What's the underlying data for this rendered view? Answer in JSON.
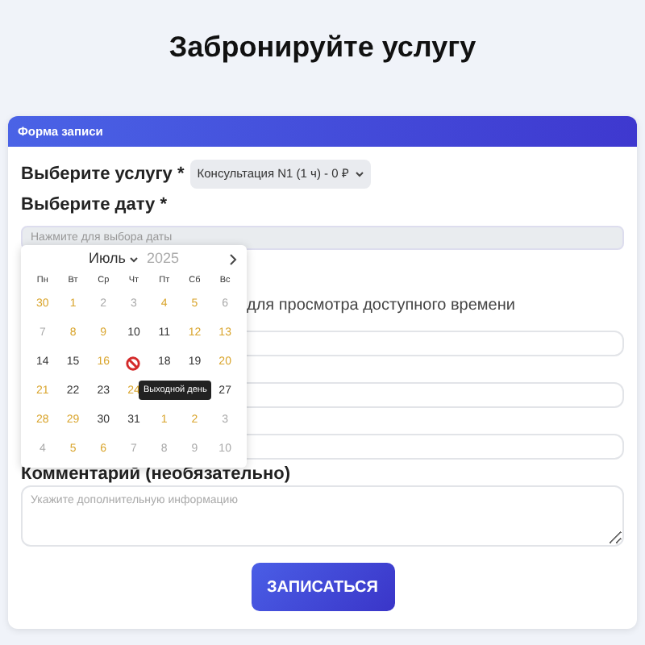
{
  "page_title": "Забронируйте услугу",
  "form": {
    "header": "Форма записи",
    "service": {
      "label": "Выберите услугу *",
      "value": "Консультация N1 (1 ч) - 0 ₽"
    },
    "date": {
      "label": "Выберите дату *",
      "placeholder": "Нажмите для выбора даты"
    },
    "time_hint": "для просмотра доступного времени",
    "covered_fields": [
      {
        "kind": "input"
      },
      {
        "kind": "input"
      },
      {
        "kind": "input"
      }
    ],
    "comment": {
      "label": "Комментарий (необязательно)",
      "placeholder": "Укажите дополнительную информацию"
    },
    "submit": "ЗАПИСАТЬСЯ"
  },
  "calendar": {
    "month": "Июль",
    "year": "2025",
    "weekdays": [
      "Пн",
      "Вт",
      "Ср",
      "Чт",
      "Пт",
      "Сб",
      "Вс"
    ],
    "weeks": [
      [
        {
          "text": "30",
          "kind": "available"
        },
        {
          "text": "1",
          "kind": "available"
        },
        {
          "text": "2",
          "kind": "muted"
        },
        {
          "text": "3",
          "kind": "muted"
        },
        {
          "text": "4",
          "kind": "available"
        },
        {
          "text": "5",
          "kind": "available"
        },
        {
          "text": "6",
          "kind": "muted"
        }
      ],
      [
        {
          "text": "7",
          "kind": "muted"
        },
        {
          "text": "8",
          "kind": "available"
        },
        {
          "text": "9",
          "kind": "available"
        },
        {
          "text": "10",
          "kind": "normal"
        },
        {
          "text": "11",
          "kind": "normal"
        },
        {
          "text": "12",
          "kind": "available"
        },
        {
          "text": "13",
          "kind": "available"
        }
      ],
      [
        {
          "text": "14",
          "kind": "normal"
        },
        {
          "text": "15",
          "kind": "normal"
        },
        {
          "text": "16",
          "kind": "available"
        },
        {
          "kind": "blocked"
        },
        {
          "text": "18",
          "kind": "normal"
        },
        {
          "text": "19",
          "kind": "normal"
        },
        {
          "text": "20",
          "kind": "available"
        }
      ],
      [
        {
          "text": "21",
          "kind": "available"
        },
        {
          "text": "22",
          "kind": "normal"
        },
        {
          "text": "23",
          "kind": "normal"
        },
        {
          "text": "24",
          "kind": "available"
        },
        {
          "kind": "covered"
        },
        {
          "kind": "covered"
        },
        {
          "text": "27",
          "kind": "normal"
        }
      ],
      [
        {
          "text": "28",
          "kind": "available"
        },
        {
          "text": "29",
          "kind": "available"
        },
        {
          "text": "30",
          "kind": "normal"
        },
        {
          "text": "31",
          "kind": "normal"
        },
        {
          "text": "1",
          "kind": "available"
        },
        {
          "text": "2",
          "kind": "available"
        },
        {
          "text": "3",
          "kind": "muted"
        }
      ],
      [
        {
          "text": "4",
          "kind": "muted"
        },
        {
          "text": "5",
          "kind": "available"
        },
        {
          "text": "6",
          "kind": "available"
        },
        {
          "text": "7",
          "kind": "muted"
        },
        {
          "text": "8",
          "kind": "muted"
        },
        {
          "text": "9",
          "kind": "muted"
        },
        {
          "text": "10",
          "kind": "muted"
        }
      ]
    ],
    "tooltip": "Выходной день"
  }
}
